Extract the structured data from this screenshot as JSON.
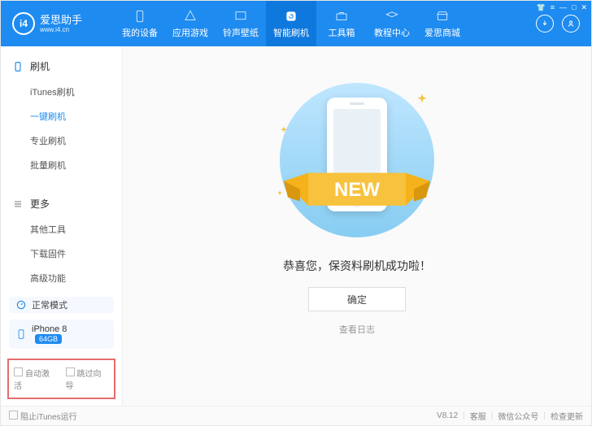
{
  "app": {
    "name": "爱思助手",
    "url": "www.i4.cn",
    "logo_text": "i4"
  },
  "top_tabs": [
    {
      "label": "我的设备"
    },
    {
      "label": "应用游戏"
    },
    {
      "label": "铃声壁纸"
    },
    {
      "label": "智能刷机",
      "active": true
    },
    {
      "label": "工具箱"
    },
    {
      "label": "教程中心"
    },
    {
      "label": "爱思商城"
    }
  ],
  "sidebar": {
    "flash_head": "刷机",
    "flash_items": [
      {
        "label": "iTunes刷机"
      },
      {
        "label": "一键刷机",
        "active": true
      },
      {
        "label": "专业刷机"
      },
      {
        "label": "批量刷机"
      }
    ],
    "more_head": "更多",
    "more_items": [
      {
        "label": "其他工具"
      },
      {
        "label": "下载固件"
      },
      {
        "label": "高级功能"
      }
    ],
    "mode_label": "正常模式",
    "device_name": "iPhone 8",
    "device_badge": "64GB",
    "auto_activate": "自动激活",
    "skip_wizard": "跳过向导"
  },
  "main": {
    "ribbon_text": "NEW",
    "success_msg": "恭喜您，保资料刷机成功啦！",
    "ok": "确定",
    "view_log": "查看日志"
  },
  "footer": {
    "block_itunes": "阻止iTunes运行",
    "version": "V8.12",
    "support": "客服",
    "wechat": "微信公众号",
    "update": "检查更新"
  }
}
